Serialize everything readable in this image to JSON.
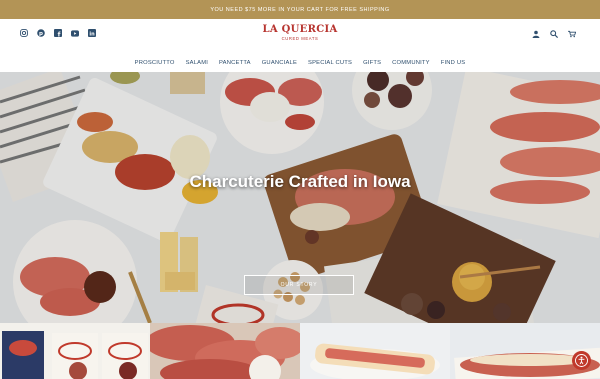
{
  "announcement": "YOU NEED $75 MORE IN YOUR CART FOR FREE SHIPPING",
  "social_icons": [
    "instagram-icon",
    "pinterest-icon",
    "facebook-icon",
    "youtube-icon",
    "linkedin-icon"
  ],
  "logo": {
    "name": "LA QUERCIA",
    "sub": "CURED MEATS"
  },
  "tools": [
    "account-icon",
    "search-icon",
    "cart-icon"
  ],
  "nav": [
    "PROSCIUTTO",
    "SALAMI",
    "PANCETTA",
    "GUANCIALE",
    "SPECIAL CUTS",
    "GIFTS",
    "COMMUNITY",
    "FIND US"
  ],
  "hero": {
    "title": "Charcuterie Crafted in Iowa",
    "button": "OUR STORY"
  },
  "colors": {
    "announce_bg": "#b39456",
    "logo": "#b7342f",
    "nav": "#2f4f6e",
    "accessibility": "#c0392b"
  }
}
